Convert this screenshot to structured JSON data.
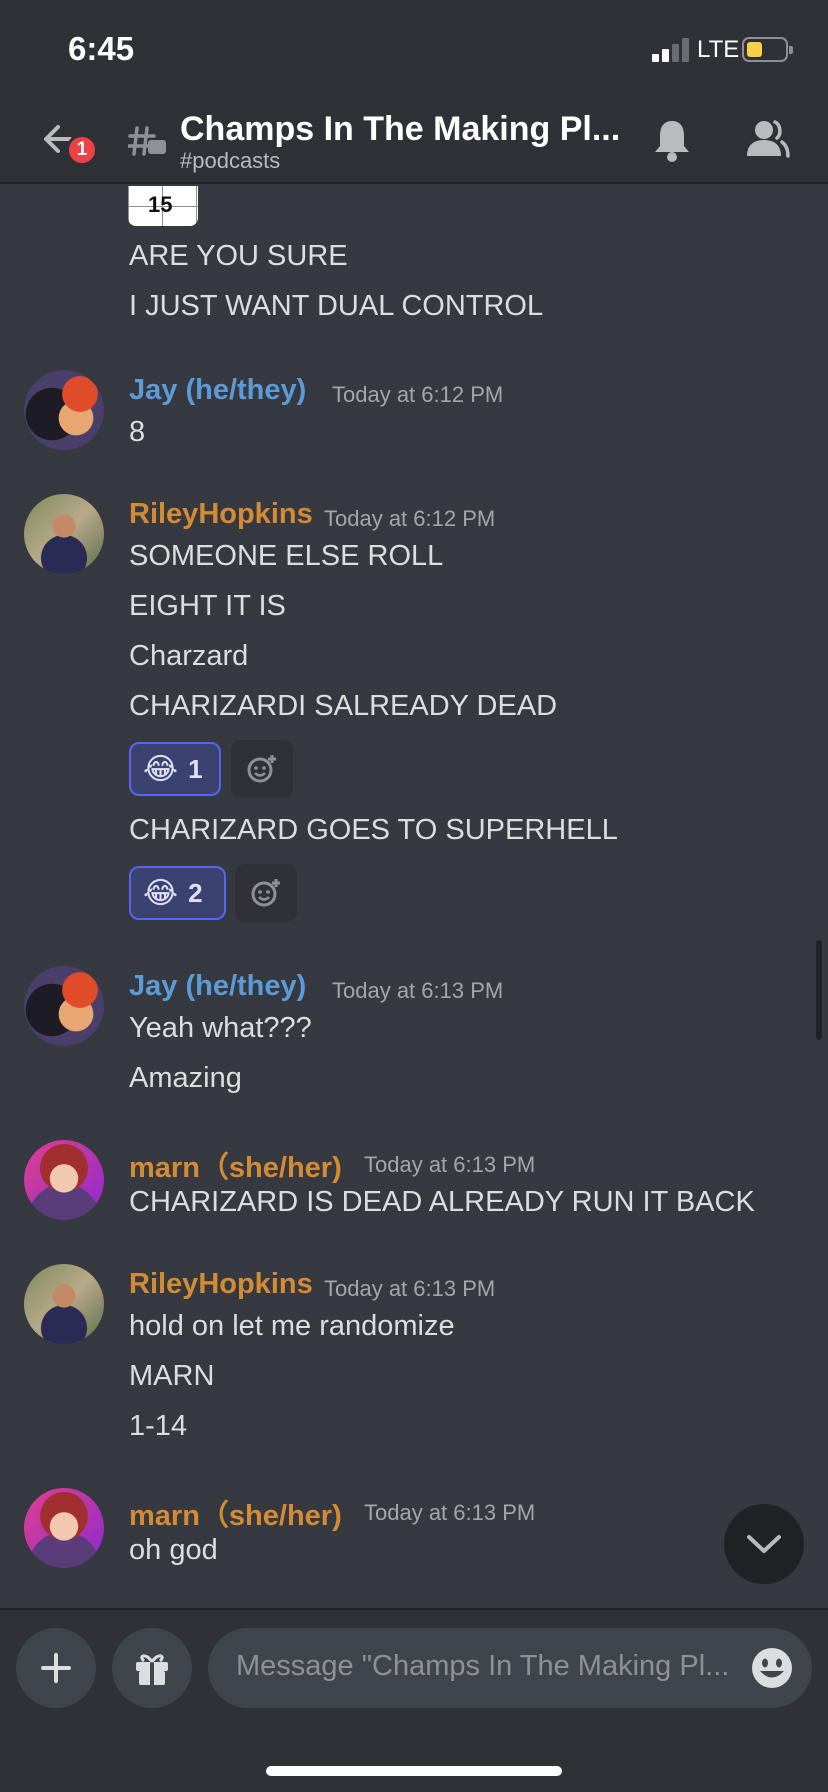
{
  "status_bar": {
    "time": "6:45",
    "network": "LTE"
  },
  "header": {
    "back_badge_count": "1",
    "channel_title": "Champs In The Making Pl...",
    "channel_subtitle": "#podcasts"
  },
  "messages": {
    "image_thumb_text": "15",
    "m0_lines": [
      "ARE YOU SURE",
      "I JUST WANT DUAL CONTROL"
    ],
    "m1": {
      "author": "Jay (he/they)",
      "timestamp": "Today at 6:12 PM",
      "lines": [
        "8"
      ]
    },
    "m2": {
      "author": "RileyHopkins",
      "timestamp": "Today at 6:12 PM",
      "lines": [
        "SOMEONE ELSE ROLL",
        "EIGHT IT IS",
        "Charzard",
        "CHARIZARDI SALREADY DEAD"
      ],
      "reaction1": {
        "emoji": "😂",
        "count": "1"
      },
      "line5": "CHARIZARD GOES TO SUPERHELL",
      "reaction2": {
        "emoji": "😂",
        "count": "2"
      }
    },
    "m3": {
      "author": "Jay (he/they)",
      "timestamp": "Today at 6:13 PM",
      "lines": [
        "Yeah what???",
        "Amazing"
      ]
    },
    "m4": {
      "author": "marn（she/her)",
      "timestamp": "Today at 6:13 PM",
      "lines": [
        "CHARIZARD IS DEAD ALREADY RUN IT BACK"
      ]
    },
    "m5": {
      "author": "RileyHopkins",
      "timestamp": "Today at 6:13 PM",
      "lines": [
        "hold on let me randomize",
        "MARN",
        "1-14"
      ]
    },
    "m6": {
      "author": "marn（she/her)",
      "timestamp": "Today at 6:13 PM",
      "lines": [
        "oh god"
      ]
    }
  },
  "composer": {
    "placeholder": "Message \"Champs In The Making Pl..."
  },
  "colors": {
    "background": "#36393f",
    "header": "#2f3136",
    "blurple": "#5865f2",
    "author_blue": "#5b9bd8",
    "author_orange": "#d38b35"
  },
  "icons": [
    "back-arrow-icon",
    "channel-thread-icon",
    "bell-icon",
    "members-icon",
    "add-reaction-icon",
    "chevron-down-icon",
    "plus-icon",
    "gift-icon",
    "emoji-icon"
  ]
}
